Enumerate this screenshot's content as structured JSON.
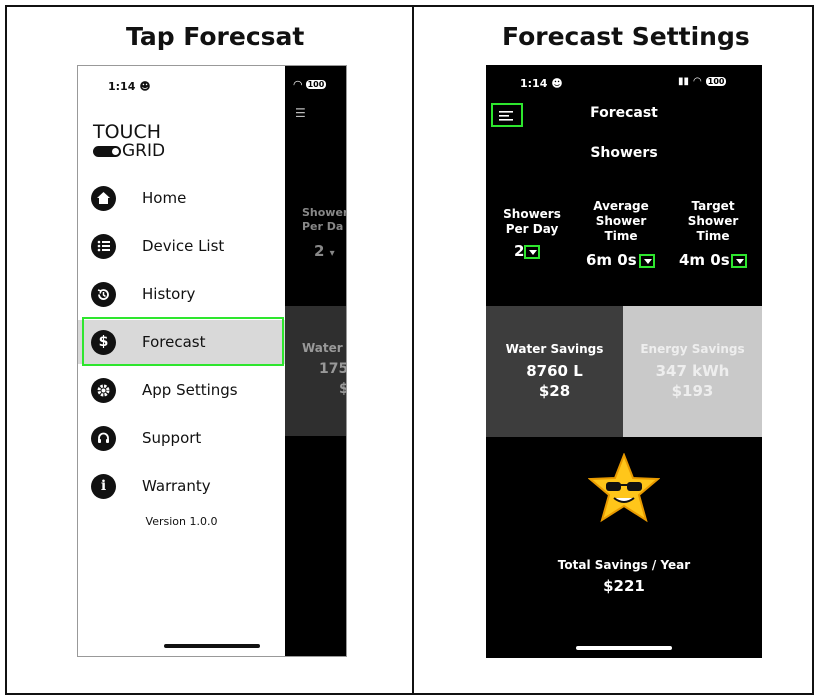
{
  "panels": {
    "left_title": "Tap Forecsat",
    "right_title": "Forecast Settings"
  },
  "phone_left": {
    "time": "1:14",
    "battery": "100",
    "logo_top": "TOUCH",
    "logo_bottom": "GRID",
    "menu": [
      {
        "label": "Home",
        "icon": "home-icon"
      },
      {
        "label": "Device List",
        "icon": "list-icon"
      },
      {
        "label": "History",
        "icon": "history-icon"
      },
      {
        "label": "Forecast",
        "icon": "dollar-icon"
      },
      {
        "label": "App Settings",
        "icon": "gear-icon"
      },
      {
        "label": "Support",
        "icon": "headset-icon"
      },
      {
        "label": "Warranty",
        "icon": "info-icon"
      }
    ],
    "version": "Version 1.0.0",
    "behind": {
      "showers_label": "Shower\nPer Da",
      "showers_value": "2",
      "water_label": "Water",
      "water_value": "175",
      "water_money": "$"
    }
  },
  "phone_right": {
    "time": "1:14",
    "battery": "100",
    "header_title": "Forecast",
    "section_title": "Showers",
    "showers_per_day": {
      "label": "Showers Per Day",
      "value": "2"
    },
    "avg_time": {
      "label": "Average Shower Time",
      "value": "6m 0s"
    },
    "target_time": {
      "label": "Target Shower Time",
      "value": "4m 0s"
    },
    "water_savings": {
      "label": "Water Savings",
      "amount": "8760 L",
      "money": "$28"
    },
    "energy_savings": {
      "label": "Energy Savings",
      "amount": "347 kWh",
      "money": "$193"
    },
    "total_label": "Total Savings / Year",
    "total_value": "$221"
  },
  "colors": {
    "highlight": "#2ee62e",
    "water_bg": "#3d3d3d",
    "energy_bg": "#c9c9c9"
  }
}
